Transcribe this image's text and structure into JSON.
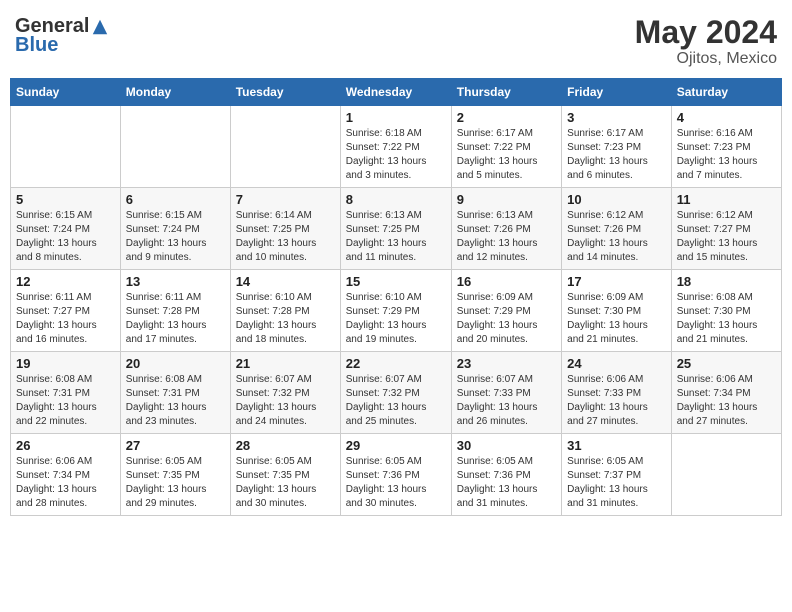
{
  "header": {
    "logo_general": "General",
    "logo_blue": "Blue",
    "month": "May 2024",
    "location": "Ojitos, Mexico"
  },
  "days_of_week": [
    "Sunday",
    "Monday",
    "Tuesday",
    "Wednesday",
    "Thursday",
    "Friday",
    "Saturday"
  ],
  "weeks": [
    [
      {
        "num": "",
        "sunrise": "",
        "sunset": "",
        "daylight": ""
      },
      {
        "num": "",
        "sunrise": "",
        "sunset": "",
        "daylight": ""
      },
      {
        "num": "",
        "sunrise": "",
        "sunset": "",
        "daylight": ""
      },
      {
        "num": "1",
        "sunrise": "Sunrise: 6:18 AM",
        "sunset": "Sunset: 7:22 PM",
        "daylight": "Daylight: 13 hours and 3 minutes."
      },
      {
        "num": "2",
        "sunrise": "Sunrise: 6:17 AM",
        "sunset": "Sunset: 7:22 PM",
        "daylight": "Daylight: 13 hours and 5 minutes."
      },
      {
        "num": "3",
        "sunrise": "Sunrise: 6:17 AM",
        "sunset": "Sunset: 7:23 PM",
        "daylight": "Daylight: 13 hours and 6 minutes."
      },
      {
        "num": "4",
        "sunrise": "Sunrise: 6:16 AM",
        "sunset": "Sunset: 7:23 PM",
        "daylight": "Daylight: 13 hours and 7 minutes."
      }
    ],
    [
      {
        "num": "5",
        "sunrise": "Sunrise: 6:15 AM",
        "sunset": "Sunset: 7:24 PM",
        "daylight": "Daylight: 13 hours and 8 minutes."
      },
      {
        "num": "6",
        "sunrise": "Sunrise: 6:15 AM",
        "sunset": "Sunset: 7:24 PM",
        "daylight": "Daylight: 13 hours and 9 minutes."
      },
      {
        "num": "7",
        "sunrise": "Sunrise: 6:14 AM",
        "sunset": "Sunset: 7:25 PM",
        "daylight": "Daylight: 13 hours and 10 minutes."
      },
      {
        "num": "8",
        "sunrise": "Sunrise: 6:13 AM",
        "sunset": "Sunset: 7:25 PM",
        "daylight": "Daylight: 13 hours and 11 minutes."
      },
      {
        "num": "9",
        "sunrise": "Sunrise: 6:13 AM",
        "sunset": "Sunset: 7:26 PM",
        "daylight": "Daylight: 13 hours and 12 minutes."
      },
      {
        "num": "10",
        "sunrise": "Sunrise: 6:12 AM",
        "sunset": "Sunset: 7:26 PM",
        "daylight": "Daylight: 13 hours and 14 minutes."
      },
      {
        "num": "11",
        "sunrise": "Sunrise: 6:12 AM",
        "sunset": "Sunset: 7:27 PM",
        "daylight": "Daylight: 13 hours and 15 minutes."
      }
    ],
    [
      {
        "num": "12",
        "sunrise": "Sunrise: 6:11 AM",
        "sunset": "Sunset: 7:27 PM",
        "daylight": "Daylight: 13 hours and 16 minutes."
      },
      {
        "num": "13",
        "sunrise": "Sunrise: 6:11 AM",
        "sunset": "Sunset: 7:28 PM",
        "daylight": "Daylight: 13 hours and 17 minutes."
      },
      {
        "num": "14",
        "sunrise": "Sunrise: 6:10 AM",
        "sunset": "Sunset: 7:28 PM",
        "daylight": "Daylight: 13 hours and 18 minutes."
      },
      {
        "num": "15",
        "sunrise": "Sunrise: 6:10 AM",
        "sunset": "Sunset: 7:29 PM",
        "daylight": "Daylight: 13 hours and 19 minutes."
      },
      {
        "num": "16",
        "sunrise": "Sunrise: 6:09 AM",
        "sunset": "Sunset: 7:29 PM",
        "daylight": "Daylight: 13 hours and 20 minutes."
      },
      {
        "num": "17",
        "sunrise": "Sunrise: 6:09 AM",
        "sunset": "Sunset: 7:30 PM",
        "daylight": "Daylight: 13 hours and 21 minutes."
      },
      {
        "num": "18",
        "sunrise": "Sunrise: 6:08 AM",
        "sunset": "Sunset: 7:30 PM",
        "daylight": "Daylight: 13 hours and 21 minutes."
      }
    ],
    [
      {
        "num": "19",
        "sunrise": "Sunrise: 6:08 AM",
        "sunset": "Sunset: 7:31 PM",
        "daylight": "Daylight: 13 hours and 22 minutes."
      },
      {
        "num": "20",
        "sunrise": "Sunrise: 6:08 AM",
        "sunset": "Sunset: 7:31 PM",
        "daylight": "Daylight: 13 hours and 23 minutes."
      },
      {
        "num": "21",
        "sunrise": "Sunrise: 6:07 AM",
        "sunset": "Sunset: 7:32 PM",
        "daylight": "Daylight: 13 hours and 24 minutes."
      },
      {
        "num": "22",
        "sunrise": "Sunrise: 6:07 AM",
        "sunset": "Sunset: 7:32 PM",
        "daylight": "Daylight: 13 hours and 25 minutes."
      },
      {
        "num": "23",
        "sunrise": "Sunrise: 6:07 AM",
        "sunset": "Sunset: 7:33 PM",
        "daylight": "Daylight: 13 hours and 26 minutes."
      },
      {
        "num": "24",
        "sunrise": "Sunrise: 6:06 AM",
        "sunset": "Sunset: 7:33 PM",
        "daylight": "Daylight: 13 hours and 27 minutes."
      },
      {
        "num": "25",
        "sunrise": "Sunrise: 6:06 AM",
        "sunset": "Sunset: 7:34 PM",
        "daylight": "Daylight: 13 hours and 27 minutes."
      }
    ],
    [
      {
        "num": "26",
        "sunrise": "Sunrise: 6:06 AM",
        "sunset": "Sunset: 7:34 PM",
        "daylight": "Daylight: 13 hours and 28 minutes."
      },
      {
        "num": "27",
        "sunrise": "Sunrise: 6:05 AM",
        "sunset": "Sunset: 7:35 PM",
        "daylight": "Daylight: 13 hours and 29 minutes."
      },
      {
        "num": "28",
        "sunrise": "Sunrise: 6:05 AM",
        "sunset": "Sunset: 7:35 PM",
        "daylight": "Daylight: 13 hours and 30 minutes."
      },
      {
        "num": "29",
        "sunrise": "Sunrise: 6:05 AM",
        "sunset": "Sunset: 7:36 PM",
        "daylight": "Daylight: 13 hours and 30 minutes."
      },
      {
        "num": "30",
        "sunrise": "Sunrise: 6:05 AM",
        "sunset": "Sunset: 7:36 PM",
        "daylight": "Daylight: 13 hours and 31 minutes."
      },
      {
        "num": "31",
        "sunrise": "Sunrise: 6:05 AM",
        "sunset": "Sunset: 7:37 PM",
        "daylight": "Daylight: 13 hours and 31 minutes."
      },
      {
        "num": "",
        "sunrise": "",
        "sunset": "",
        "daylight": ""
      }
    ]
  ]
}
